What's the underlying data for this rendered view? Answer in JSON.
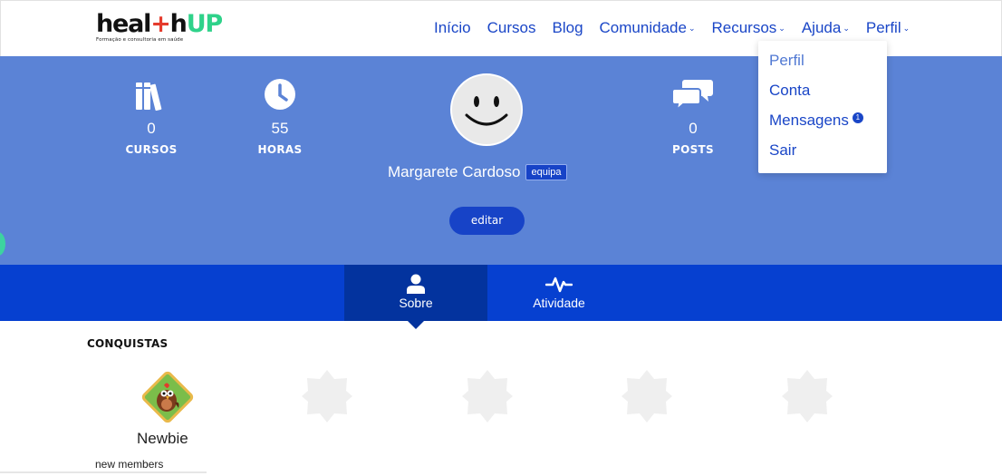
{
  "brand": {
    "logo_part1": "heal",
    "logo_cross": "+",
    "logo_part2": "h",
    "logo_part3": "UP",
    "tagline": "Formação e consultoria em saúde",
    "colors": {
      "dark": "#111111",
      "cross": "#e53b2c",
      "up": "#2fd28a"
    }
  },
  "nav": {
    "items": [
      {
        "label": "Início",
        "has_caret": false
      },
      {
        "label": "Cursos",
        "has_caret": false
      },
      {
        "label": "Blog",
        "has_caret": false
      },
      {
        "label": "Comunidade",
        "has_caret": true
      },
      {
        "label": "Recursos",
        "has_caret": true
      },
      {
        "label": "Ajuda",
        "has_caret": true
      },
      {
        "label": "Perfil",
        "has_caret": true
      }
    ],
    "caret_glyph": "⌄"
  },
  "profile_dropdown": {
    "items": [
      {
        "label": "Perfil"
      },
      {
        "label": "Conta"
      },
      {
        "label": "Mensagens",
        "badge": "1"
      },
      {
        "label": "Sair"
      }
    ]
  },
  "stats": {
    "courses": {
      "value": "0",
      "label": "CURSOS",
      "icon": "books-icon"
    },
    "hours": {
      "value": "55",
      "label": "HORAS",
      "icon": "clock-icon"
    },
    "posts": {
      "value": "0",
      "label": "POSTS",
      "icon": "chat-bubbles-icon"
    }
  },
  "user": {
    "name": "Margarete Cardoso",
    "role_badge": "equipa",
    "edit_label": "editar"
  },
  "tabs": [
    {
      "label": "Sobre",
      "icon": "user-icon",
      "active": true
    },
    {
      "label": "Atividade",
      "icon": "activity-pulse-icon",
      "active": false
    }
  ],
  "achievements": {
    "title": "CONQUISTAS",
    "earned": {
      "name": "Newbie",
      "description": "new members"
    },
    "locked_count": 4
  },
  "theme": {
    "hero_bg": "#5b83d6",
    "tab_bg": "#0640d0",
    "tab_active_bg": "#03339e",
    "link": "#1a46c7"
  }
}
